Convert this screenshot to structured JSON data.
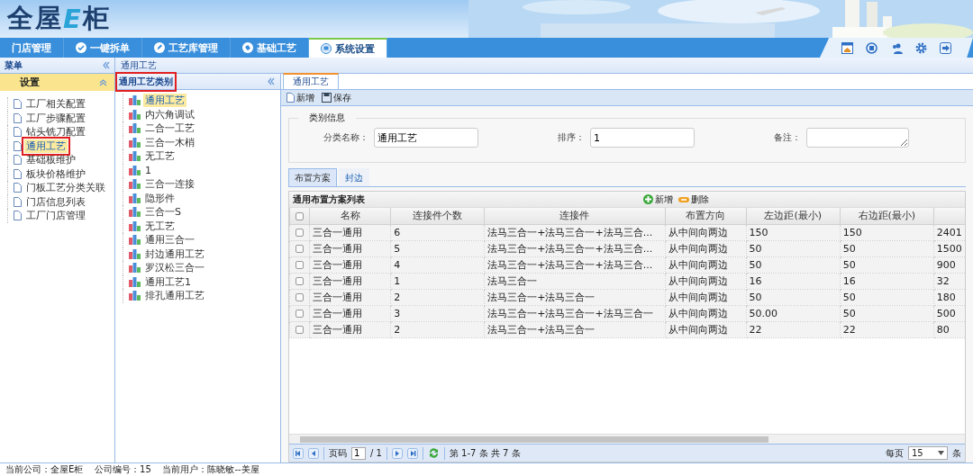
{
  "logo": {
    "part_1": "全屋",
    "part_2": "E",
    "part_3": "柜"
  },
  "nav_tabs": [
    {
      "label": "门店管理",
      "selected": false
    },
    {
      "label": "一键拆单",
      "selected": false
    },
    {
      "label": "工艺库管理",
      "selected": false
    },
    {
      "label": "基础工艺",
      "selected": false
    },
    {
      "label": "系统设置",
      "selected": true
    }
  ],
  "menu": {
    "title": "菜单",
    "group": "设置",
    "items": [
      {
        "label": "工厂相关配置",
        "selected": false,
        "annotated": false
      },
      {
        "label": "工厂步骤配置",
        "selected": false,
        "annotated": false
      },
      {
        "label": "钻头铣刀配置",
        "selected": false,
        "annotated": false
      },
      {
        "label": "通用工艺",
        "selected": true,
        "annotated": true
      },
      {
        "label": "基础板维护",
        "selected": false,
        "annotated": false
      },
      {
        "label": "板块价格维护",
        "selected": false,
        "annotated": false
      },
      {
        "label": "门板工艺分类关联",
        "selected": false,
        "annotated": false
      },
      {
        "label": "门店信息列表",
        "selected": false,
        "annotated": false
      },
      {
        "label": "工厂门店管理",
        "selected": false,
        "annotated": false
      }
    ]
  },
  "breadcrumb": "通用工艺",
  "category_tree": {
    "title": "通用工艺类别",
    "annotated": true,
    "items": [
      {
        "label": "通用工艺",
        "selected": true
      },
      {
        "label": "内六角调试",
        "selected": false
      },
      {
        "label": "二合一工艺",
        "selected": false
      },
      {
        "label": "三合一木梢",
        "selected": false
      },
      {
        "label": "无工艺",
        "selected": false
      },
      {
        "label": "1",
        "selected": false
      },
      {
        "label": "三合一连接",
        "selected": false
      },
      {
        "label": "隐形件",
        "selected": false
      },
      {
        "label": "三合一S",
        "selected": false
      },
      {
        "label": "无工艺",
        "selected": false
      },
      {
        "label": "通用三合一",
        "selected": false
      },
      {
        "label": "封边通用工艺",
        "selected": false
      },
      {
        "label": "罗汉松三合一",
        "selected": false
      },
      {
        "label": "通用工艺1",
        "selected": false
      },
      {
        "label": "排孔通用工艺",
        "selected": false
      }
    ]
  },
  "detail_tab": "通用工艺",
  "toolbar": [
    "新增",
    "保存"
  ],
  "form": {
    "legend": "类别信息",
    "fields": [
      {
        "label": "分类名称：",
        "value": "通用工艺",
        "kind": "input"
      },
      {
        "label": "排序：",
        "value": "1",
        "kind": "input"
      },
      {
        "label": "备注：",
        "kind": "textarea"
      }
    ]
  },
  "sub_tabs": [
    {
      "label": "布置方案",
      "selected": true
    },
    {
      "label": "封边",
      "selected": false
    }
  ],
  "table": {
    "title": "通用布置方案列表",
    "all_checked": false,
    "actions": [
      {
        "label": "新增",
        "kind": "add"
      },
      {
        "label": "删除",
        "kind": "remove"
      }
    ],
    "columns": [
      "名称",
      "连接件个数",
      "连接件",
      "布置方向",
      "左边距(最小)",
      "右边距(最小)"
    ],
    "rows": [
      {
        "checked": false,
        "cells": [
          "三合一通用",
          "6",
          "法马三合一+法马三合一+法马三合...",
          "从中间向两边",
          "150",
          "150",
          "2401"
        ]
      },
      {
        "checked": false,
        "cells": [
          "三合一通用",
          "5",
          "法马三合一+法马三合一+法马三合...",
          "从中间向两边",
          "50",
          "50",
          "1500"
        ]
      },
      {
        "checked": false,
        "cells": [
          "三合一通用",
          "4",
          "法马三合一+法马三合一+法马三合...",
          "从中间向两边",
          "50",
          "50",
          "900"
        ]
      },
      {
        "checked": false,
        "cells": [
          "三合一通用",
          "1",
          "法马三合一",
          "从中间向两边",
          "16",
          "16",
          "32"
        ]
      },
      {
        "checked": false,
        "cells": [
          "三合一通用",
          "2",
          "法马三合一+法马三合一",
          "从中间向两边",
          "50",
          "50",
          "180"
        ]
      },
      {
        "checked": false,
        "cells": [
          "三合一通用",
          "3",
          "法马三合一+法马三合一+法马三合一",
          "从中间向两边",
          "50.00",
          "50",
          "500"
        ]
      },
      {
        "checked": false,
        "cells": [
          "三合一通用",
          "2",
          "法马三合一+法马三合一",
          "从中间向两边",
          "22",
          "22",
          "80"
        ]
      }
    ]
  },
  "pager": {
    "page_label": "页码",
    "page": "1",
    "total_pages": "/ 1",
    "summary": "第 1-7 条  共 7 条",
    "per_page_label": "每页",
    "per_page": "15",
    "unit": "条"
  },
  "status_bar": "当前公司：全屋E柜    公司编号：15    当前用户：陈晓敏--美屋"
}
